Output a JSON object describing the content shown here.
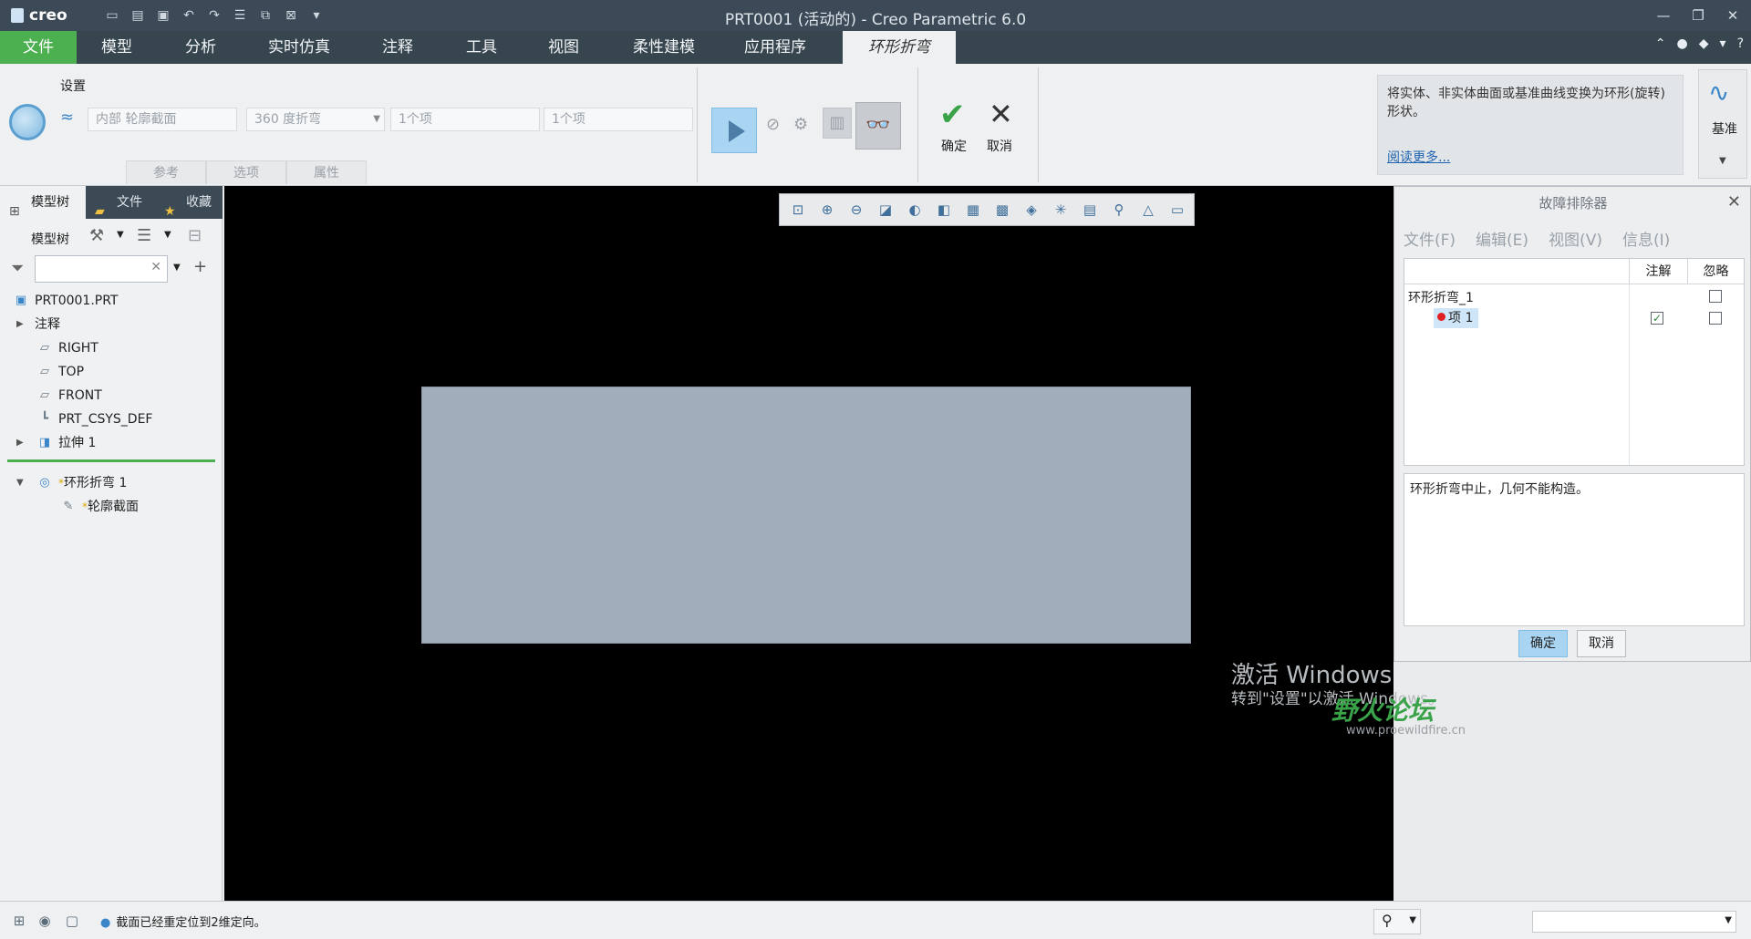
{
  "app": {
    "logo": "creo",
    "window_title": "PRT0001 (活动的) - Creo Parametric 6.0"
  },
  "ribbon_tabs": [
    {
      "label": "文件"
    },
    {
      "label": "模型"
    },
    {
      "label": "分析"
    },
    {
      "label": "实时仿真"
    },
    {
      "label": "注释"
    },
    {
      "label": "工具"
    },
    {
      "label": "视图"
    },
    {
      "label": "柔性建模"
    },
    {
      "label": "应用程序"
    },
    {
      "label": "环形折弯"
    }
  ],
  "ribbon": {
    "settings_label": "设置",
    "profile_field": "内部 轮廓截面",
    "bend_field": "360 度折弯",
    "items_field_1": "1个项",
    "items_field_2": "1个项",
    "subtabs": [
      "参考",
      "选项",
      "属性"
    ],
    "ok_label": "确定",
    "cancel_label": "取消",
    "help_text": "将实体、非实体曲面或基准曲线变换为环形(旋转) 形状。",
    "help_link": "阅读更多...",
    "datum_label": "基准"
  },
  "left_panel": {
    "tabs": [
      "模型树",
      "文件",
      "收藏"
    ],
    "toolbar_label": "模型树",
    "tree": [
      {
        "label": "PRT0001.PRT"
      },
      {
        "label": "注释"
      },
      {
        "label": "RIGHT"
      },
      {
        "label": "TOP"
      },
      {
        "label": "FRONT"
      },
      {
        "label": "PRT_CSYS_DEF"
      },
      {
        "label": "拉伸 1"
      },
      {
        "label": "环形折弯 1"
      },
      {
        "label": "轮廓截面"
      }
    ]
  },
  "troubleshooter": {
    "title": "故障排除器",
    "menu": [
      "文件(F)",
      "编辑(E)",
      "视图(V)",
      "信息(I)"
    ],
    "col_note": "注解",
    "col_ignore": "忽略",
    "feature_row": "环形折弯_1",
    "item_row": "项 1",
    "message": "环形折弯中止，几何不能构造。",
    "ok_label": "确定",
    "cancel_label": "取消"
  },
  "watermark": {
    "line1": "激活 Windows",
    "line2": "转到\"设置\"以激活 Windows。",
    "forum": "野火论坛",
    "url": "www.proewildfire.cn"
  },
  "status": {
    "message": "截面已经重定位到2维定向。"
  }
}
